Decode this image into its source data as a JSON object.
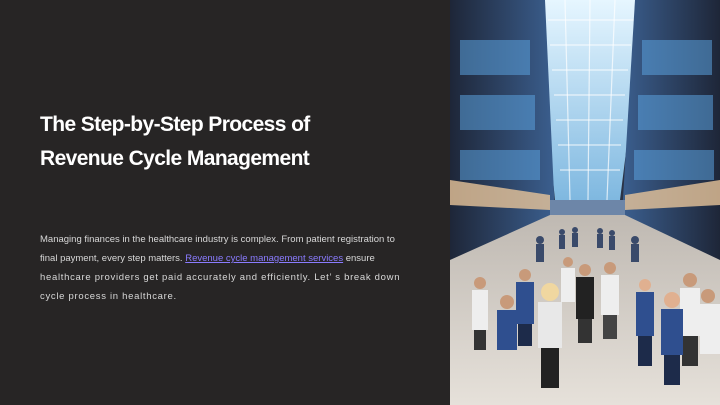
{
  "slide": {
    "title_line1": "The Step-by-Step Process of",
    "title_line2": "Revenue Cycle Management",
    "body": {
      "line1": " Managing finances in the healthcare industry is complex. From patient registration to",
      "line2_pre": "final payment, every step matters. ",
      "link_text": "Revenue cycle management services",
      "line2_post": " ensure",
      "line3": "healthcare providers get paid accurately and efficiently. Let’   s break down",
      "line4": "cycle process in healthcare."
    }
  },
  "image": {
    "alt": "hospital-atrium-photo",
    "colors": {
      "skylight": "#bfe3f5",
      "glass_blue": "#3f7fc0",
      "wall_dark": "#2a3346",
      "floor": "#d9d4cc",
      "scrubs_blue": "#2f4f8f",
      "coat_white": "#eeeeee"
    }
  }
}
